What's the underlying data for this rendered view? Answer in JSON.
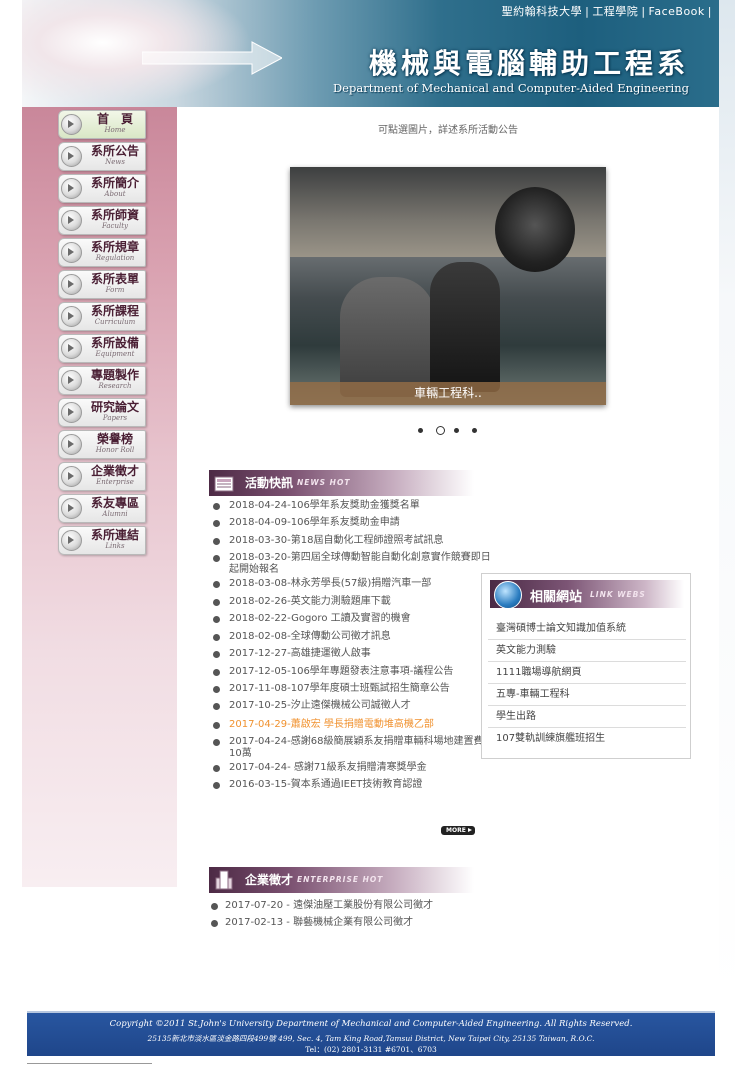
{
  "header": {
    "top_links": [
      "聖約翰科技大學",
      "工程學院",
      "FaceBook"
    ],
    "title_zh": "機械與電腦輔助工程系",
    "title_en": "Department of Mechanical and Computer-Aided Engineering"
  },
  "menu": [
    {
      "zh": "首　頁",
      "en": "Home"
    },
    {
      "zh": "系所公告",
      "en": "News"
    },
    {
      "zh": "系所簡介",
      "en": "About"
    },
    {
      "zh": "系所師資",
      "en": "Faculty"
    },
    {
      "zh": "系所規章",
      "en": "Regulation"
    },
    {
      "zh": "系所表單",
      "en": "Form"
    },
    {
      "zh": "系所課程",
      "en": "Curriculum"
    },
    {
      "zh": "系所設備",
      "en": "Equipment"
    },
    {
      "zh": "專題製作",
      "en": "Research"
    },
    {
      "zh": "研究論文",
      "en": "Papers"
    },
    {
      "zh": "榮譽榜",
      "en": "Honor Roll"
    },
    {
      "zh": "企業徵才",
      "en": "Enterprise"
    },
    {
      "zh": "系友專區",
      "en": "Alumni"
    },
    {
      "zh": "系所連結",
      "en": "Links"
    }
  ],
  "slider": {
    "hint": "可點選圖片，詳述系所活動公告",
    "caption": "車輛工程科..",
    "slide_count": 4,
    "active_index": 1
  },
  "news": {
    "title_zh": "活動快訊",
    "title_en": "NEWS HOT",
    "items": [
      {
        "text": "2018-04-24-106學年系友獎助金獲獎名單",
        "highlight": false
      },
      {
        "text": "2018-04-09-106學年系友獎助金申請",
        "highlight": false
      },
      {
        "text": "2018-03-30-第18屆自動化工程師證照考試訊息",
        "highlight": false
      },
      {
        "text": "2018-03-20-第四屆全球傳動智能自動化創意實作競賽即日起開始報名",
        "highlight": false
      },
      {
        "text": "2018-03-08-林永芳學長(57級)捐贈汽車一部",
        "highlight": false
      },
      {
        "text": "2018-02-26-英文能力測驗題庫下載",
        "highlight": false
      },
      {
        "text": "2018-02-22-Gogoro 工讀及實習的機會",
        "highlight": false
      },
      {
        "text": "2018-02-08-全球傳動公司徵才訊息",
        "highlight": false
      },
      {
        "text": "2017-12-27-高雄捷運徵人啟事",
        "highlight": false
      },
      {
        "text": "2017-12-05-106學年專題發表注意事項-議程公告",
        "highlight": false
      },
      {
        "text": "2017-11-08-107學年度碩士班甄試招生簡章公告",
        "highlight": false
      },
      {
        "text": "2017-10-25-汐止遠傑機械公司誠徵人才",
        "highlight": false
      },
      {
        "text": "2017-04-29-蕭啟宏 學長捐贈電動堆高機乙部",
        "highlight": true
      },
      {
        "text": "2017-04-24-感謝68級簡展穎系友捐贈車輛科場地建置費10萬",
        "highlight": false
      },
      {
        "text": "2017-04-24- 感謝71級系友捐贈清寒獎學金",
        "highlight": false
      },
      {
        "text": "2016-03-15-賀本系通過IEET技術教育認證",
        "highlight": false
      }
    ],
    "more_label": "MORE"
  },
  "links": {
    "title_zh": "相關網站",
    "title_en": "LINK WEBS",
    "items": [
      "臺灣碩博士論文知識加值系統",
      "英文能力測驗",
      "1111職場導航網頁",
      "五專-車輛工程科",
      "學生出路",
      "107雙軌訓練旗艦班招生"
    ]
  },
  "enterprise": {
    "title_zh": "企業徵才",
    "title_en": "ENTERPRISE HOT",
    "items": [
      "2017-07-20 - 遠傑油壓工業股份有限公司徵才",
      "2017-02-13 - 聯藝機械企業有限公司徵才"
    ]
  },
  "footer": {
    "line1": "Copyright ©2011 St.John's University  Department of Mechanical and Computer-Aided Engineering. All Rights Reserved.",
    "line2": "25135新北市淡水區淡金路四段499號    499, Sec. 4, Tam King Road,Tamsui District, New Taipei City, 25135 Taiwan, R.O.C.",
    "line3": "Tel：(02) 2801-3131 #6701、6703"
  }
}
